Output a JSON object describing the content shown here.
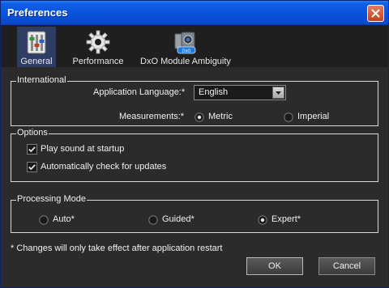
{
  "window": {
    "title": "Preferences"
  },
  "toolbar": {
    "tabs": [
      {
        "label": "General",
        "icon": "sliders-icon",
        "active": true
      },
      {
        "label": "Performance",
        "icon": "gear-icon",
        "active": false
      },
      {
        "label": "DxO Module Ambiguity",
        "icon": "camera-module-icon",
        "active": false
      }
    ]
  },
  "international": {
    "title": "International",
    "language_label": "Application Language:*",
    "language_value": "English",
    "measurements_label": "Measurements:*",
    "measurement_options": [
      "Metric",
      "Imperial"
    ],
    "measurement_selected": "Metric"
  },
  "options": {
    "title": "Options",
    "items": [
      {
        "label": "Play sound at startup",
        "checked": true
      },
      {
        "label": "Automatically check for updates",
        "checked": true
      }
    ]
  },
  "processing": {
    "title": "Processing Mode",
    "modes": [
      "Auto*",
      "Guided*",
      "Expert*"
    ],
    "selected": "Expert*"
  },
  "footer": {
    "note": "* Changes will only take effect after application restart",
    "ok_label": "OK",
    "cancel_label": "Cancel"
  },
  "colors": {
    "titlebar": "#0b55de",
    "background": "#2b2b2b",
    "active_tab": "#2e3d63",
    "close_button": "#c2421c"
  }
}
